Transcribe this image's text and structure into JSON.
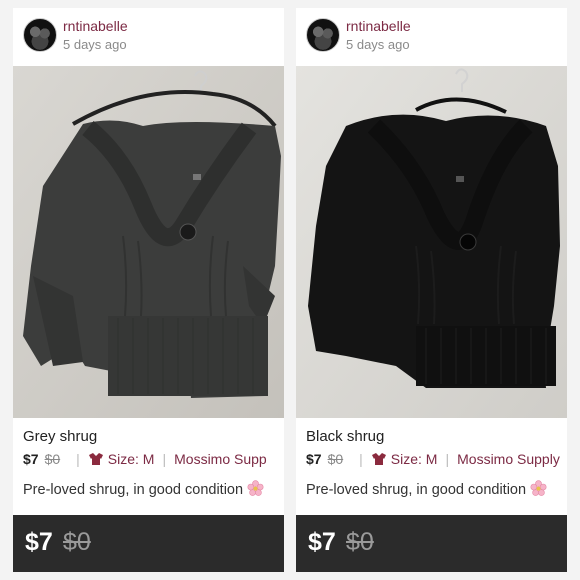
{
  "colors": {
    "username": "#7c2a44",
    "footer_bg": "#2b2b2b",
    "grey_item": "#3c3d3c",
    "black_item": "#141414"
  },
  "listings": [
    {
      "username": "rntinabelle",
      "time_ago": "5 days ago",
      "title": "Grey shrug",
      "price": "$7",
      "original_price": "$0",
      "size": "Size: M",
      "brand": "Mossimo Supp",
      "description": "Pre-loved shrug, in good condition",
      "footer_price": "$7",
      "footer_original_price": "$0"
    },
    {
      "username": "rntinabelle",
      "time_ago": "5 days ago",
      "title": "Black shrug",
      "price": "$7",
      "original_price": "$0",
      "size": "Size: M",
      "brand": "Mossimo Supply",
      "description": "Pre-loved shrug, in good condition",
      "footer_price": "$7",
      "footer_original_price": "$0"
    }
  ]
}
